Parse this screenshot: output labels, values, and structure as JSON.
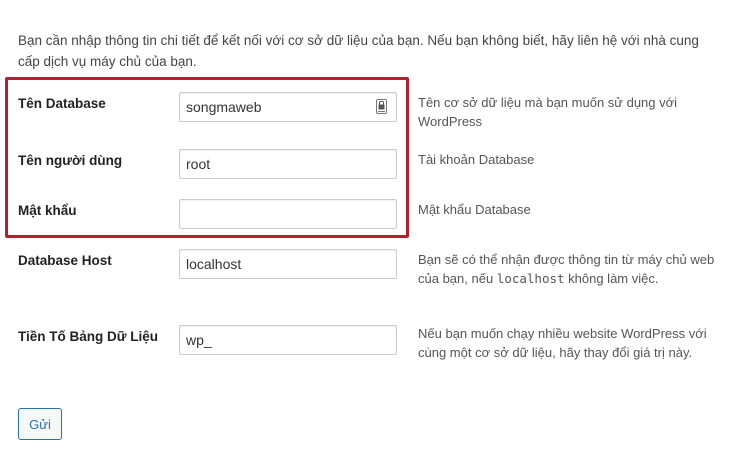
{
  "intro_text": "Bạn cần nhập thông tin chi tiết để kết nối với cơ sở dữ liệu của bạn. Nếu bạn không biết, hãy liên hệ với nhà cung cấp dịch vụ máy chủ của bạn.",
  "fields": {
    "dbname": {
      "label": "Tên Database",
      "value": "songmaweb",
      "placeholder": "",
      "description": "Tên cơ sở dữ liệu mà bạn muốn sử dụng với WordPress"
    },
    "username": {
      "label": "Tên người dùng",
      "value": "root",
      "placeholder": "",
      "description": "Tài khoản Database"
    },
    "password": {
      "label": "Mật khẩu",
      "value": "",
      "placeholder": "",
      "description": "Mật khẩu Database"
    },
    "dbhost": {
      "label": "Database Host",
      "value": "localhost",
      "placeholder": "",
      "description_before": "Bạn sẽ có thể nhận được thông tin từ máy chủ web của bạn, nếu ",
      "description_code": "localhost",
      "description_after": " không làm việc."
    },
    "prefix": {
      "label": "Tiền Tố Bảng Dữ Liệu",
      "value": "wp_",
      "placeholder": "",
      "description": "Nếu bạn muốn chạy nhiều website WordPress với cùng một cơ sở dữ liệu, hãy thay đổi giá trị này."
    }
  },
  "submit_label": "Gửi",
  "colors": {
    "highlight": "#b5202e",
    "button_accent": "#2271b1"
  },
  "icons": {
    "password_manager": "keypass-icon"
  }
}
